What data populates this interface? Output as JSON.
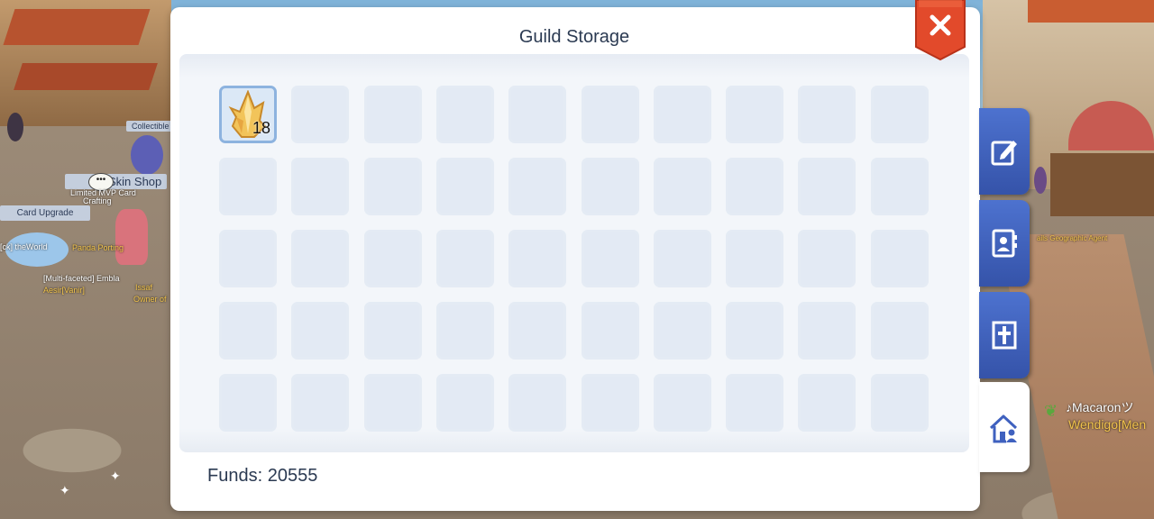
{
  "panel": {
    "title": "Guild Storage",
    "funds_label": "Funds: 20555",
    "close_icon": "close-icon",
    "grid": {
      "columns": 10,
      "visible_rows": 5
    },
    "items": [
      {
        "slot": 0,
        "icon": "crystal-icon",
        "quantity": "18"
      }
    ]
  },
  "side_tabs": [
    {
      "icon": "edit-icon",
      "active": false
    },
    {
      "icon": "contacts-icon",
      "active": false
    },
    {
      "icon": "guild-emblem-icon",
      "active": false
    },
    {
      "icon": "guild-house-icon",
      "active": true
    }
  ],
  "world_labels": {
    "collectible": "Collectible Sk",
    "skin_shop": "Skin Shop",
    "limited_mvp": "Limited MVP Card",
    "crafting": "Crafting",
    "card_upgrade": "Card Upgrade",
    "panda": "Panda Porting",
    "the_world": "[ck] theWorld",
    "multifaceted": "[Multi-faceted] Embla",
    "aesir": "Aesir[Vanir]",
    "issaf": "Issaf",
    "owner": "Owner of",
    "agent": "ails Geographic Agent",
    "macaron": "♪Macaronツ",
    "wendigo": "Wendigo[Men"
  },
  "colors": {
    "panel_title": "#2b3a52",
    "slot_bg": "#e3eaf4",
    "slot_border": "#e4ebf4",
    "selected_border": "#8db3df",
    "close_red": "#e24a2b",
    "tab_blue": "#3f61bf",
    "gold_text": "#f2c44c"
  }
}
